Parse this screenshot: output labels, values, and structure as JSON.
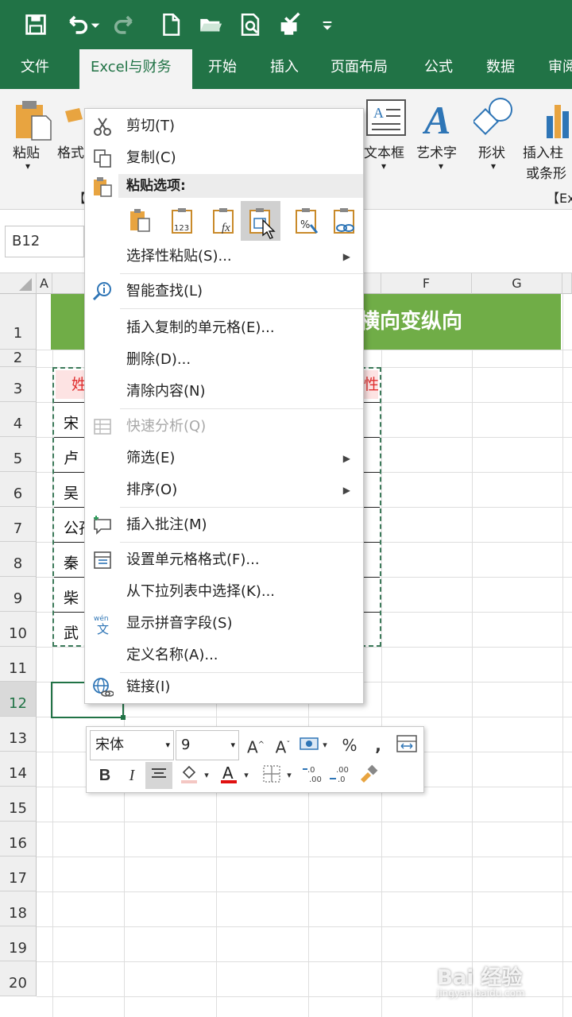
{
  "tabs": [
    "文件",
    "Excel与财务",
    "开始",
    "插入",
    "页面布局",
    "公式",
    "数据",
    "审阅"
  ],
  "ribbon": {
    "paste": "粘贴",
    "format_painter": "格式",
    "textbox": "文本框",
    "wordart": "艺术字",
    "shapes": "形状",
    "insert_chart_line1": "插入柱",
    "insert_chart_line2": "或条形",
    "group_left": "【",
    "group_right": "【Ex"
  },
  "namebox": "B12",
  "columns": [
    "A",
    "F",
    "G"
  ],
  "rows": [
    "1",
    "2",
    "3",
    "4",
    "5",
    "6",
    "7",
    "8",
    "9",
    "10",
    "11",
    "12",
    "13",
    "14",
    "15",
    "16",
    "17",
    "18",
    "19",
    "20"
  ],
  "sheet": {
    "title": "横向变纵向",
    "header_left": "姓",
    "header_right": "性",
    "names": [
      "宋",
      "卢",
      "吴",
      "公孙",
      "秦",
      "柴",
      "武"
    ]
  },
  "context_menu": {
    "cut": "剪切(T)",
    "copy": "复制(C)",
    "paste_options": "粘贴选项:",
    "paste_special": "选择性粘贴(S)...",
    "smart_lookup": "智能查找(L)",
    "insert_copied": "插入复制的单元格(E)...",
    "delete": "删除(D)...",
    "clear": "清除内容(N)",
    "quick_analysis": "快速分析(Q)",
    "filter": "筛选(E)",
    "sort": "排序(O)",
    "insert_comment": "插入批注(M)",
    "format_cells": "设置单元格格式(F)...",
    "pick_list": "从下拉列表中选择(K)...",
    "phonetic": "显示拼音字段(S)",
    "define_name": "定义名称(A)...",
    "link": "链接(I)"
  },
  "mini_toolbar": {
    "font": "宋体",
    "size": "9",
    "bold": "B",
    "italic": "I",
    "percent": "%",
    "comma": ","
  },
  "watermark": {
    "brand": "Bai 经验",
    "url": "jingyan.baidu.com"
  },
  "colors": {
    "excel_green": "#217346",
    "title_band": "#70ad47",
    "header_fill": "#fde3e3",
    "header_text": "#e03030"
  }
}
